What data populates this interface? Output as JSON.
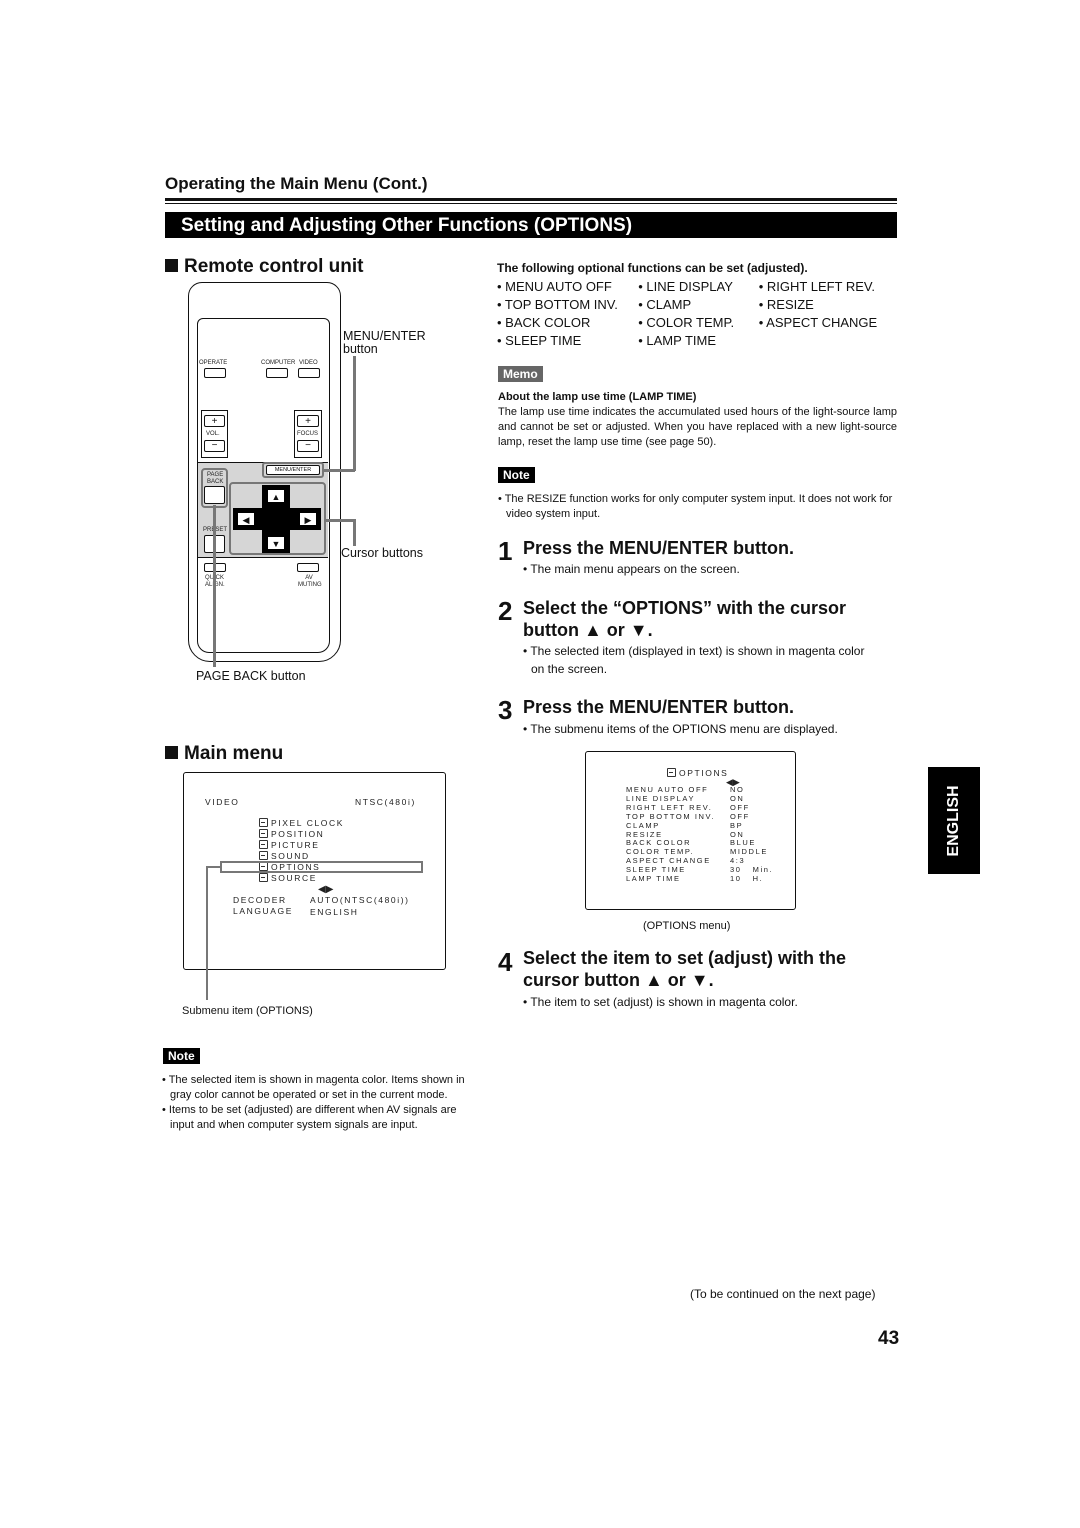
{
  "section_header": "Operating the Main Menu (Cont.)",
  "banner_title": "Setting and Adjusting Other Functions (OPTIONS)",
  "remote": {
    "heading": "Remote control unit",
    "buttons": {
      "operate": "OPERATE",
      "computer": "COMPUTER",
      "video": "VIDEO",
      "vol_plus": "+",
      "vol_label": "VOL.",
      "vol_minus": "−",
      "focus_plus": "+",
      "focus_label": "FOCUS",
      "focus_minus": "−",
      "menu_enter": "MENU/ENTER",
      "page_back_1": "PAGE",
      "page_back_2": "BACK",
      "preset": "PRESET",
      "up": "▲",
      "down": "▼",
      "left": "◀",
      "right": "▶",
      "quick_align_1": "QUICK",
      "quick_align_2": "ALIGN.",
      "av_muting_1": "AV",
      "av_muting_2": "MUTING"
    },
    "callouts": {
      "menu_enter_1": "MENU/ENTER",
      "menu_enter_2": "button",
      "cursor": "Cursor buttons",
      "page_back": "PAGE BACK button"
    }
  },
  "options_intro": {
    "heading": "The following optional functions can be set (adjusted).",
    "items": [
      [
        "• MENU AUTO OFF",
        "• LINE DISPLAY",
        "• RIGHT LEFT REV."
      ],
      [
        "• TOP BOTTOM INV.",
        "• CLAMP",
        "• RESIZE"
      ],
      [
        "• BACK COLOR",
        "• COLOR TEMP.",
        "• ASPECT CHANGE"
      ],
      [
        "• SLEEP TIME",
        "• LAMP TIME",
        ""
      ]
    ]
  },
  "memo": {
    "tag": "Memo",
    "title": "About the lamp use time (LAMP TIME)",
    "body": "The lamp use time indicates the accumulated used hours of the light-source lamp and cannot be set or adjusted. When you have replaced with a new light-source lamp, reset the lamp use time (see page 50)."
  },
  "note_right": {
    "tag": "Note",
    "items": [
      "• The RESIZE function works for only computer system input. It does not work for video system input."
    ]
  },
  "steps": [
    {
      "num": "1",
      "title": "Press the MENU/ENTER button.",
      "subs": [
        "• The main menu appears on the screen."
      ]
    },
    {
      "num": "2",
      "title_1": "Select the “OPTIONS” with the cursor",
      "title_2": "button ▲ or ▼.",
      "subs": [
        "• The selected item (displayed in text) is shown in magenta color",
        "on the screen."
      ]
    },
    {
      "num": "3",
      "title": "Press the MENU/ENTER button.",
      "subs": [
        "• The submenu items of the OPTIONS menu are displayed."
      ]
    },
    {
      "num": "4",
      "title_1": "Select the item to set (adjust) with the",
      "title_2": "cursor button ▲ or ▼.",
      "subs": [
        "• The item to set (adjust) is shown in magenta color."
      ]
    }
  ],
  "main_menu": {
    "heading": "Main menu",
    "source": "VIDEO",
    "signal": "NTSC(480i)",
    "items": [
      "PIXEL CLOCK",
      "POSITION",
      "PICTURE",
      "SOUND",
      "OPTIONS",
      "SOURCE"
    ],
    "selected": "OPTIONS",
    "adjust_icon": "◀▶",
    "settings": [
      {
        "label": "DECODER",
        "value": "AUTO(NTSC(480i))"
      },
      {
        "label": "LANGUAGE",
        "value": "ENGLISH"
      }
    ],
    "callout": "Submenu item (OPTIONS)"
  },
  "options_menu": {
    "title": "OPTIONS",
    "adjust_icon": "◀▶",
    "rows": [
      {
        "label": "MENU AUTO OFF",
        "value": "NO"
      },
      {
        "label": "LINE DISPLAY",
        "value": "ON"
      },
      {
        "label": "RIGHT LEFT REV.",
        "value": "OFF"
      },
      {
        "label": "TOP BOTTOM INV.",
        "value": "OFF"
      },
      {
        "label": "CLAMP",
        "value": "BP"
      },
      {
        "label": "RESIZE",
        "value": "ON"
      },
      {
        "label": "BACK COLOR",
        "value": "BLUE"
      },
      {
        "label": "COLOR TEMP.",
        "value": "MIDDLE"
      },
      {
        "label": "ASPECT CHANGE",
        "value": "4:3"
      },
      {
        "label": "SLEEP TIME",
        "value": "30   Min."
      },
      {
        "label": "LAMP TIME",
        "value": "10   H."
      }
    ],
    "caption": "(OPTIONS menu)"
  },
  "note_left": {
    "tag": "Note",
    "items": [
      "• The selected item is shown in magenta color. Items shown in gray color cannot be operated or set in the current mode.",
      "• Items to be set (adjusted) are different when AV signals are input and when computer system signals are input."
    ]
  },
  "language_tab": "ENGLISH",
  "continued": "(To be continued on the next page)",
  "page_number": "43"
}
